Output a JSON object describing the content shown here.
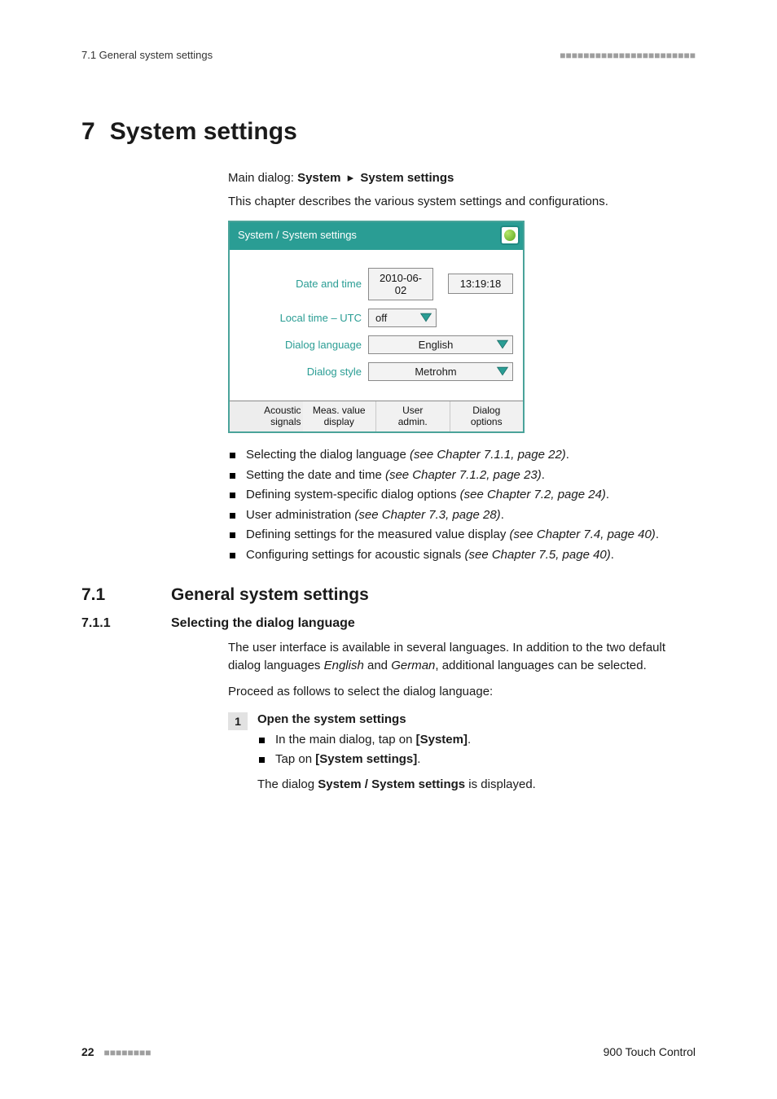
{
  "header": {
    "left": "7.1 General system settings",
    "dots": "■■■■■■■■■■■■■■■■■■■■■■■"
  },
  "chapter": {
    "num": "7",
    "title": "System settings"
  },
  "breadcrumb": {
    "prefix": "Main dialog: ",
    "item1": "System",
    "arrow": "▸",
    "item2": "System settings"
  },
  "intro": "This chapter describes the various system settings and configurations.",
  "figure": {
    "title": "System / System settings",
    "rows": {
      "date_label": "Date and time",
      "date_value": "2010-06-02",
      "time_value": "13:19:18",
      "local_label": "Local time – UTC",
      "local_value": "off",
      "lang_label": "Dialog language",
      "lang_value": "English",
      "style_label": "Dialog style",
      "style_value": "Metrohm"
    },
    "footerButtons": {
      "b1a": "Acoustic",
      "b1b": "signals",
      "b2a": "Meas. value",
      "b2b": "display",
      "b3a": "User",
      "b3b": "admin.",
      "b4a": "Dialog",
      "b4b": "options"
    }
  },
  "bullets": [
    {
      "text": "Selecting the dialog language ",
      "ref": "(see Chapter 7.1.1, page 22)",
      "suffix": "."
    },
    {
      "text": "Setting the date and time ",
      "ref": "(see Chapter 7.1.2, page 23)",
      "suffix": "."
    },
    {
      "text": "Defining system-specific dialog options ",
      "ref": "(see Chapter 7.2, page 24)",
      "suffix": "."
    },
    {
      "text": "User administration ",
      "ref": "(see Chapter 7.3, page 28)",
      "suffix": "."
    },
    {
      "text": "Defining settings for the measured value display ",
      "ref": "(see Chapter 7.4, page 40)",
      "suffix": "."
    },
    {
      "text": "Configuring settings for acoustic signals ",
      "ref": "(see Chapter 7.5, page 40)",
      "suffix": "."
    }
  ],
  "section": {
    "num": "7.1",
    "title": "General system settings"
  },
  "subsection": {
    "num": "7.1.1",
    "title": "Selecting the dialog language"
  },
  "subsection_body": {
    "p1a": "The user interface is available in several languages. In addition to the two default dialog languages ",
    "p1b": "English",
    "p1c": " and ",
    "p1d": "German",
    "p1e": ", additional languages can be selected.",
    "p2": "Proceed as follows to select the dialog language:"
  },
  "steps": {
    "s1": {
      "num": "1",
      "title": "Open the system settings",
      "items": [
        {
          "pre": "In the main dialog, tap on ",
          "strong": "[System]",
          "post": "."
        },
        {
          "pre": "Tap on ",
          "strong": "[System settings]",
          "post": "."
        }
      ],
      "result_a": "The dialog ",
      "result_b": "System / System settings",
      "result_c": " is displayed."
    }
  },
  "footer": {
    "pageno": "22",
    "dots": "■■■■■■■■",
    "product": "900 Touch Control"
  }
}
